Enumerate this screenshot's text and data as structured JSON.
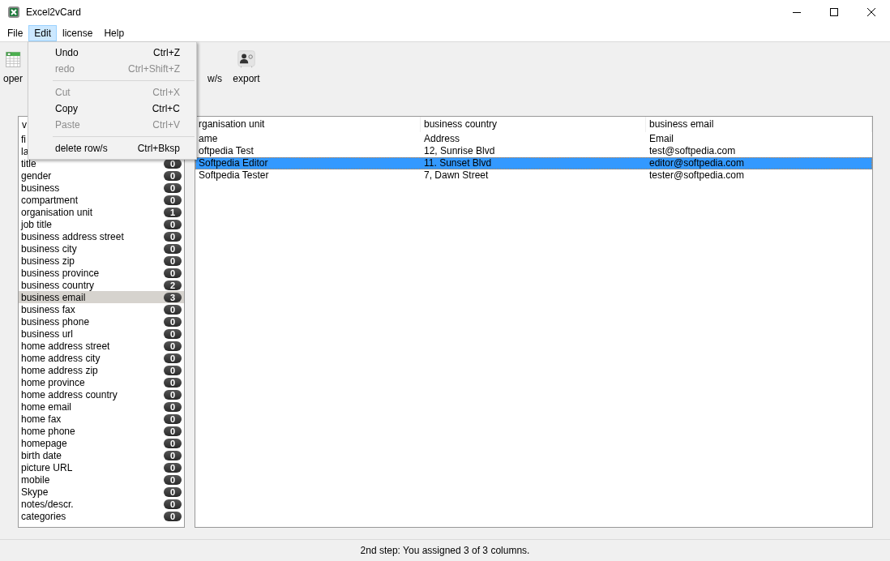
{
  "window": {
    "title": "Excel2vCard"
  },
  "menu_bar": [
    {
      "label": "File",
      "selected": false
    },
    {
      "label": "Edit",
      "selected": true
    },
    {
      "label": "license",
      "selected": false
    },
    {
      "label": "Help",
      "selected": false
    }
  ],
  "toolbar": [
    {
      "kind": "open",
      "label": "oper"
    },
    {
      "kind": "hidden",
      "label": "w/s"
    },
    {
      "kind": "export",
      "label": "export"
    }
  ],
  "edit_menu": [
    {
      "kind": "item",
      "label": "Undo",
      "shortcut": "Ctrl+Z",
      "disabled": false
    },
    {
      "kind": "item",
      "label": "redo",
      "shortcut": "Ctrl+Shift+Z",
      "disabled": true
    },
    {
      "kind": "separator"
    },
    {
      "kind": "item",
      "label": "Cut",
      "shortcut": "Ctrl+X",
      "disabled": true
    },
    {
      "kind": "item",
      "label": "Copy",
      "shortcut": "Ctrl+C",
      "disabled": false
    },
    {
      "kind": "item",
      "label": "Paste",
      "shortcut": "Ctrl+V",
      "disabled": true
    },
    {
      "kind": "separator"
    },
    {
      "kind": "item",
      "label": "delete row/s",
      "shortcut": "Ctrl+Bksp",
      "disabled": false
    }
  ],
  "field_list": {
    "header": "v",
    "items": [
      {
        "label": "fi",
        "selected": false
      },
      {
        "label": "la",
        "selected": false
      },
      {
        "label": "title",
        "count": "0",
        "selected": false
      },
      {
        "label": "gender",
        "count": "0",
        "selected": false
      },
      {
        "label": "business",
        "count": "0",
        "selected": false
      },
      {
        "label": "compartment",
        "count": "0",
        "selected": false
      },
      {
        "label": "organisation unit",
        "count": "1",
        "selected": false
      },
      {
        "label": "job title",
        "count": "0",
        "selected": false
      },
      {
        "label": "business address street",
        "count": "0",
        "selected": false
      },
      {
        "label": "business city",
        "count": "0",
        "selected": false
      },
      {
        "label": "business zip",
        "count": "0",
        "selected": false
      },
      {
        "label": "business province",
        "count": "0",
        "selected": false
      },
      {
        "label": "business country",
        "count": "2",
        "selected": false
      },
      {
        "label": "business email",
        "count": "3",
        "selected": true
      },
      {
        "label": "business fax",
        "count": "0",
        "selected": false
      },
      {
        "label": "business phone",
        "count": "0",
        "selected": false
      },
      {
        "label": "business url",
        "count": "0",
        "selected": false
      },
      {
        "label": "home address street",
        "count": "0",
        "selected": false
      },
      {
        "label": "home address city",
        "count": "0",
        "selected": false
      },
      {
        "label": "home address zip",
        "count": "0",
        "selected": false
      },
      {
        "label": "home province",
        "count": "0",
        "selected": false
      },
      {
        "label": "home address country",
        "count": "0",
        "selected": false
      },
      {
        "label": "home email",
        "count": "0",
        "selected": false
      },
      {
        "label": "home fax",
        "count": "0",
        "selected": false
      },
      {
        "label": "home phone",
        "count": "0",
        "selected": false
      },
      {
        "label": "homepage",
        "count": "0",
        "selected": false
      },
      {
        "label": "birth date",
        "count": "0",
        "selected": false
      },
      {
        "label": "picture URL",
        "count": "0",
        "selected": false
      },
      {
        "label": "mobile",
        "count": "0",
        "selected": false
      },
      {
        "label": "Skype",
        "count": "0",
        "selected": false
      },
      {
        "label": "notes/descr.",
        "count": "0",
        "selected": false
      },
      {
        "label": "categories",
        "count": "0",
        "selected": false
      }
    ]
  },
  "table": {
    "columns": [
      "rganisation unit",
      "business country",
      "business email"
    ],
    "rows": [
      {
        "cells": [
          "ame",
          "Address",
          "Email"
        ],
        "selected": false
      },
      {
        "cells": [
          "oftpedia Test",
          "12, Sunrise Blvd",
          "test@softpedia.com"
        ],
        "selected": false
      },
      {
        "cells": [
          "Softpedia Editor",
          "11. Sunset Blvd",
          "editor@softpedia.com"
        ],
        "selected": true
      },
      {
        "cells": [
          "Softpedia Tester",
          "7, Dawn Street",
          "tester@softpedia.com"
        ],
        "selected": false
      }
    ]
  },
  "status_bar": "2nd step: You assigned 3 of 3 columns."
}
